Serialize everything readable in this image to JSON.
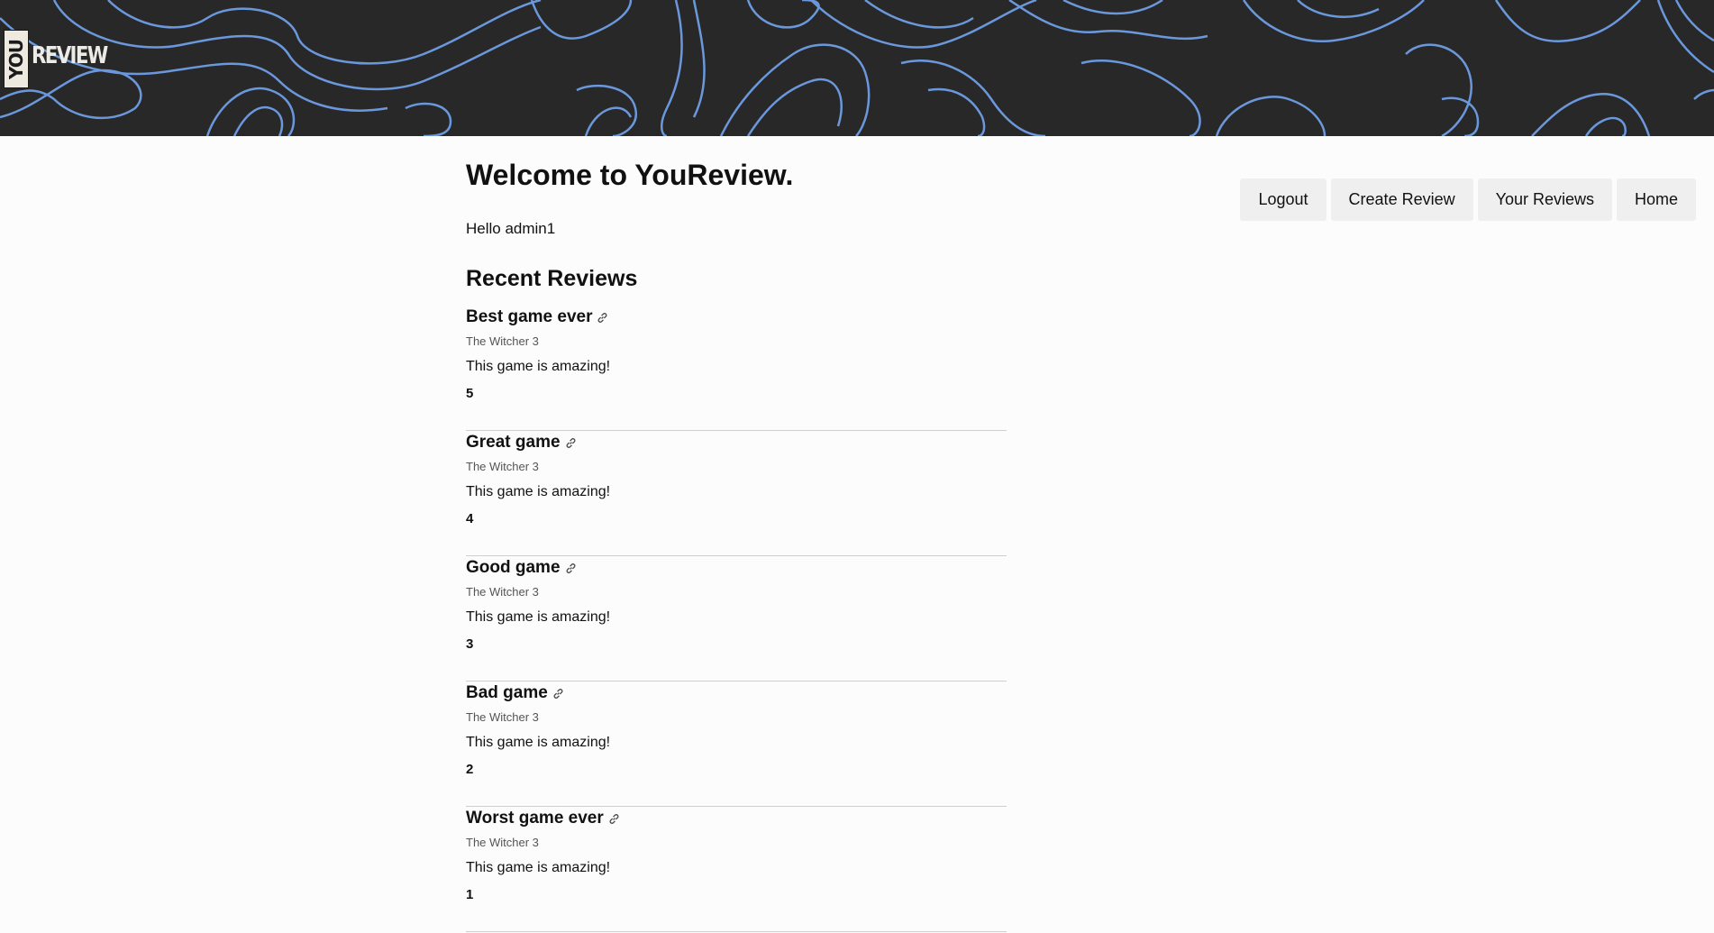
{
  "brand": {
    "logo_you": "YOU",
    "logo_review": "REVIEW"
  },
  "colors": {
    "banner_bg": "#282828",
    "banner_lines": "#6f9fe6",
    "page_bg": "#fcfcfc",
    "button_bg": "#efefef"
  },
  "nav": {
    "logout": "Logout",
    "create_review": "Create Review",
    "your_reviews": "Your Reviews",
    "home": "Home"
  },
  "main": {
    "title": "Welcome to YouReview.",
    "greeting": "Hello admin1",
    "section_title": "Recent Reviews"
  },
  "reviews": [
    {
      "title": "Best game ever",
      "game": "The Witcher 3",
      "text": "This game is amazing!",
      "score": "5"
    },
    {
      "title": "Great game",
      "game": "The Witcher 3",
      "text": "This game is amazing!",
      "score": "4"
    },
    {
      "title": "Good game",
      "game": "The Witcher 3",
      "text": "This game is amazing!",
      "score": "3"
    },
    {
      "title": "Bad game",
      "game": "The Witcher 3",
      "text": "This game is amazing!",
      "score": "2"
    },
    {
      "title": "Worst game ever",
      "game": "The Witcher 3",
      "text": "This game is amazing!",
      "score": "1"
    }
  ],
  "icons": {
    "review_link": "link-icon"
  }
}
